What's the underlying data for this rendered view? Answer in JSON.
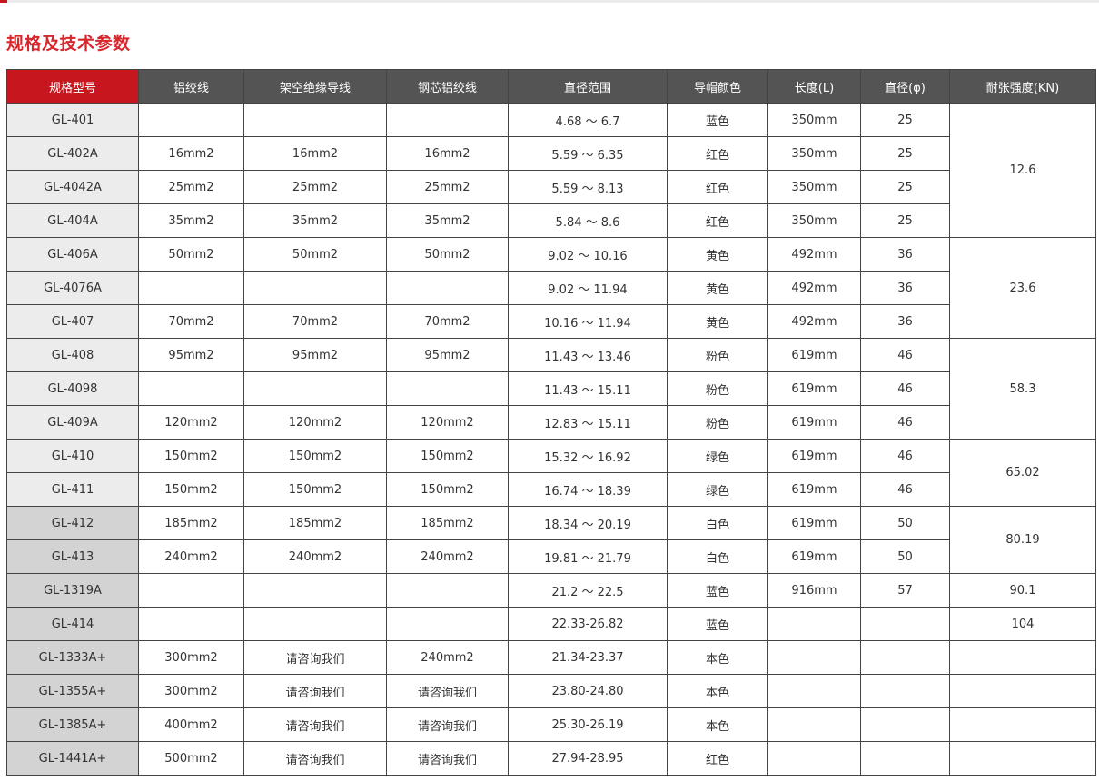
{
  "title": "规格及技术参数",
  "table": {
    "headers": [
      "规格型号",
      "铝绞线",
      "架空绝缘导线",
      "钢芯铝绞线",
      "直径范围",
      "导帽颜色",
      "长度(L)",
      "直径(φ)",
      "耐张强度(KN)"
    ],
    "rows": [
      {
        "model": "GL-401",
        "al": "",
        "ins": "",
        "acsr": "",
        "range": "4.68 ～ 6.7",
        "color": "蓝色",
        "len": "350mm",
        "dia": "25"
      },
      {
        "model": "GL-402A",
        "al": "16mm2",
        "ins": "16mm2",
        "acsr": "16mm2",
        "range": "5.59 ～ 6.35",
        "color": "红色",
        "len": "350mm",
        "dia": "25"
      },
      {
        "model": "GL-4042A",
        "al": "25mm2",
        "ins": "25mm2",
        "acsr": "25mm2",
        "range": "5.59 ～ 8.13",
        "color": "红色",
        "len": "350mm",
        "dia": "25"
      },
      {
        "model": "GL-404A",
        "al": "35mm2",
        "ins": "35mm2",
        "acsr": "35mm2",
        "range": "5.84 ～ 8.6",
        "color": "红色",
        "len": "350mm",
        "dia": "25"
      },
      {
        "model": "GL-406A",
        "al": "50mm2",
        "ins": "50mm2",
        "acsr": "50mm2",
        "range": "9.02 ～ 10.16",
        "color": "黄色",
        "len": "492mm",
        "dia": "36"
      },
      {
        "model": "GL-4076A",
        "al": "",
        "ins": "",
        "acsr": "",
        "range": "9.02 ～ 11.94",
        "color": "黄色",
        "len": "492mm",
        "dia": "36"
      },
      {
        "model": "GL-407",
        "al": "70mm2",
        "ins": "70mm2",
        "acsr": "70mm2",
        "range": "10.16 ～ 11.94",
        "color": "黄色",
        "len": "492mm",
        "dia": "36"
      },
      {
        "model": "GL-408",
        "al": "95mm2",
        "ins": "95mm2",
        "acsr": "95mm2",
        "range": "11.43 ～ 13.46",
        "color": "粉色",
        "len": "619mm",
        "dia": "46"
      },
      {
        "model": "GL-4098",
        "al": "",
        "ins": "",
        "acsr": "",
        "range": "11.43 ～ 15.11",
        "color": "粉色",
        "len": "619mm",
        "dia": "46"
      },
      {
        "model": "GL-409A",
        "al": "120mm2",
        "ins": "120mm2",
        "acsr": "120mm2",
        "range": "12.83 ～ 15.11",
        "color": "粉色",
        "len": "619mm",
        "dia": "46"
      },
      {
        "model": "GL-410",
        "al": "150mm2",
        "ins": "150mm2",
        "acsr": "150mm2",
        "range": "15.32 ～ 16.92",
        "color": "绿色",
        "len": "619mm",
        "dia": "46"
      },
      {
        "model": "GL-411",
        "al": "150mm2",
        "ins": "150mm2",
        "acsr": "150mm2",
        "range": "16.74 ～ 18.39",
        "color": "绿色",
        "len": "619mm",
        "dia": "46"
      },
      {
        "model": "GL-412",
        "al": "185mm2",
        "ins": "185mm2",
        "acsr": "185mm2",
        "range": "18.34 ～ 20.19",
        "color": "白色",
        "len": "619mm",
        "dia": "50"
      },
      {
        "model": "GL-413",
        "al": "240mm2",
        "ins": "240mm2",
        "acsr": "240mm2",
        "range": "19.81 ～ 21.79",
        "color": "白色",
        "len": "619mm",
        "dia": "50"
      },
      {
        "model": "GL-1319A",
        "al": "",
        "ins": "",
        "acsr": "",
        "range": "21.2 ～ 22.5",
        "color": "蓝色",
        "len": "916mm",
        "dia": "57"
      },
      {
        "model": "GL-414",
        "al": "",
        "ins": "",
        "acsr": "",
        "range": "22.33-26.82",
        "color": "蓝色",
        "len": "",
        "dia": ""
      },
      {
        "model": "GL-1333A+",
        "al": "300mm2",
        "ins": "请咨询我们",
        "acsr": "240mm2",
        "range": "21.34-23.37",
        "color": "本色",
        "len": "",
        "dia": ""
      },
      {
        "model": "GL-1355A+",
        "al": "300mm2",
        "ins": "请咨询我们",
        "acsr": "请咨询我们",
        "range": "23.80-24.80",
        "color": "本色",
        "len": "",
        "dia": ""
      },
      {
        "model": "GL-1385A+",
        "al": "400mm2",
        "ins": "请咨询我们",
        "acsr": "请咨询我们",
        "range": "25.30-26.19",
        "color": "本色",
        "len": "",
        "dia": ""
      },
      {
        "model": "GL-1441A+",
        "al": "500mm2",
        "ins": "请咨询我们",
        "acsr": "请咨询我们",
        "range": "27.94-28.95",
        "color": "红色",
        "len": "",
        "dia": ""
      }
    ],
    "strength_groups": [
      {
        "value": "12.6",
        "rows": 4
      },
      {
        "value": "23.6",
        "rows": 3
      },
      {
        "value": "58.3",
        "rows": 3
      },
      {
        "value": "65.02",
        "rows": 2
      },
      {
        "value": "80.19",
        "rows": 2
      },
      {
        "value": "90.1",
        "rows": 1
      },
      {
        "value": "104",
        "rows": 1
      },
      {
        "value": "",
        "rows": 1
      },
      {
        "value": "",
        "rows": 1
      },
      {
        "value": "",
        "rows": 1
      },
      {
        "value": "",
        "rows": 1
      }
    ]
  }
}
